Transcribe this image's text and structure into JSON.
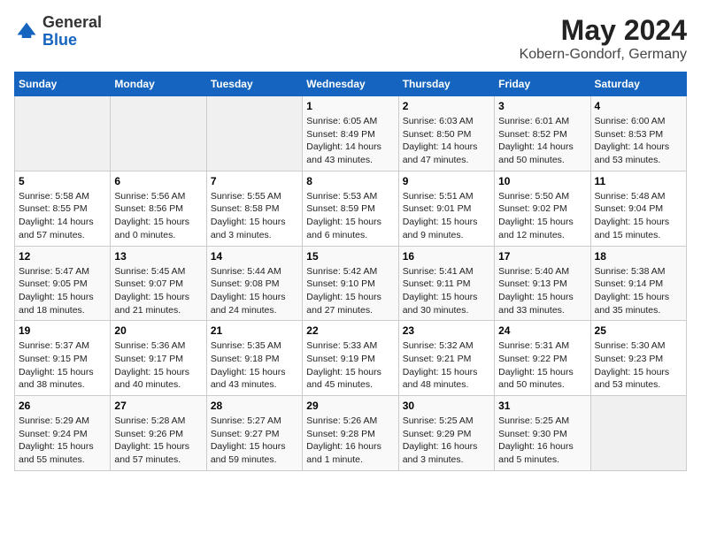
{
  "header": {
    "logo_line1": "General",
    "logo_line2": "Blue",
    "main_title": "May 2024",
    "subtitle": "Kobern-Gondorf, Germany"
  },
  "days_of_week": [
    "Sunday",
    "Monday",
    "Tuesday",
    "Wednesday",
    "Thursday",
    "Friday",
    "Saturday"
  ],
  "weeks": [
    [
      {
        "day": "",
        "info": ""
      },
      {
        "day": "",
        "info": ""
      },
      {
        "day": "",
        "info": ""
      },
      {
        "day": "1",
        "info": "Sunrise: 6:05 AM\nSunset: 8:49 PM\nDaylight: 14 hours\nand 43 minutes."
      },
      {
        "day": "2",
        "info": "Sunrise: 6:03 AM\nSunset: 8:50 PM\nDaylight: 14 hours\nand 47 minutes."
      },
      {
        "day": "3",
        "info": "Sunrise: 6:01 AM\nSunset: 8:52 PM\nDaylight: 14 hours\nand 50 minutes."
      },
      {
        "day": "4",
        "info": "Sunrise: 6:00 AM\nSunset: 8:53 PM\nDaylight: 14 hours\nand 53 minutes."
      }
    ],
    [
      {
        "day": "5",
        "info": "Sunrise: 5:58 AM\nSunset: 8:55 PM\nDaylight: 14 hours\nand 57 minutes."
      },
      {
        "day": "6",
        "info": "Sunrise: 5:56 AM\nSunset: 8:56 PM\nDaylight: 15 hours\nand 0 minutes."
      },
      {
        "day": "7",
        "info": "Sunrise: 5:55 AM\nSunset: 8:58 PM\nDaylight: 15 hours\nand 3 minutes."
      },
      {
        "day": "8",
        "info": "Sunrise: 5:53 AM\nSunset: 8:59 PM\nDaylight: 15 hours\nand 6 minutes."
      },
      {
        "day": "9",
        "info": "Sunrise: 5:51 AM\nSunset: 9:01 PM\nDaylight: 15 hours\nand 9 minutes."
      },
      {
        "day": "10",
        "info": "Sunrise: 5:50 AM\nSunset: 9:02 PM\nDaylight: 15 hours\nand 12 minutes."
      },
      {
        "day": "11",
        "info": "Sunrise: 5:48 AM\nSunset: 9:04 PM\nDaylight: 15 hours\nand 15 minutes."
      }
    ],
    [
      {
        "day": "12",
        "info": "Sunrise: 5:47 AM\nSunset: 9:05 PM\nDaylight: 15 hours\nand 18 minutes."
      },
      {
        "day": "13",
        "info": "Sunrise: 5:45 AM\nSunset: 9:07 PM\nDaylight: 15 hours\nand 21 minutes."
      },
      {
        "day": "14",
        "info": "Sunrise: 5:44 AM\nSunset: 9:08 PM\nDaylight: 15 hours\nand 24 minutes."
      },
      {
        "day": "15",
        "info": "Sunrise: 5:42 AM\nSunset: 9:10 PM\nDaylight: 15 hours\nand 27 minutes."
      },
      {
        "day": "16",
        "info": "Sunrise: 5:41 AM\nSunset: 9:11 PM\nDaylight: 15 hours\nand 30 minutes."
      },
      {
        "day": "17",
        "info": "Sunrise: 5:40 AM\nSunset: 9:13 PM\nDaylight: 15 hours\nand 33 minutes."
      },
      {
        "day": "18",
        "info": "Sunrise: 5:38 AM\nSunset: 9:14 PM\nDaylight: 15 hours\nand 35 minutes."
      }
    ],
    [
      {
        "day": "19",
        "info": "Sunrise: 5:37 AM\nSunset: 9:15 PM\nDaylight: 15 hours\nand 38 minutes."
      },
      {
        "day": "20",
        "info": "Sunrise: 5:36 AM\nSunset: 9:17 PM\nDaylight: 15 hours\nand 40 minutes."
      },
      {
        "day": "21",
        "info": "Sunrise: 5:35 AM\nSunset: 9:18 PM\nDaylight: 15 hours\nand 43 minutes."
      },
      {
        "day": "22",
        "info": "Sunrise: 5:33 AM\nSunset: 9:19 PM\nDaylight: 15 hours\nand 45 minutes."
      },
      {
        "day": "23",
        "info": "Sunrise: 5:32 AM\nSunset: 9:21 PM\nDaylight: 15 hours\nand 48 minutes."
      },
      {
        "day": "24",
        "info": "Sunrise: 5:31 AM\nSunset: 9:22 PM\nDaylight: 15 hours\nand 50 minutes."
      },
      {
        "day": "25",
        "info": "Sunrise: 5:30 AM\nSunset: 9:23 PM\nDaylight: 15 hours\nand 53 minutes."
      }
    ],
    [
      {
        "day": "26",
        "info": "Sunrise: 5:29 AM\nSunset: 9:24 PM\nDaylight: 15 hours\nand 55 minutes."
      },
      {
        "day": "27",
        "info": "Sunrise: 5:28 AM\nSunset: 9:26 PM\nDaylight: 15 hours\nand 57 minutes."
      },
      {
        "day": "28",
        "info": "Sunrise: 5:27 AM\nSunset: 9:27 PM\nDaylight: 15 hours\nand 59 minutes."
      },
      {
        "day": "29",
        "info": "Sunrise: 5:26 AM\nSunset: 9:28 PM\nDaylight: 16 hours\nand 1 minute."
      },
      {
        "day": "30",
        "info": "Sunrise: 5:25 AM\nSunset: 9:29 PM\nDaylight: 16 hours\nand 3 minutes."
      },
      {
        "day": "31",
        "info": "Sunrise: 5:25 AM\nSunset: 9:30 PM\nDaylight: 16 hours\nand 5 minutes."
      },
      {
        "day": "",
        "info": ""
      }
    ]
  ]
}
